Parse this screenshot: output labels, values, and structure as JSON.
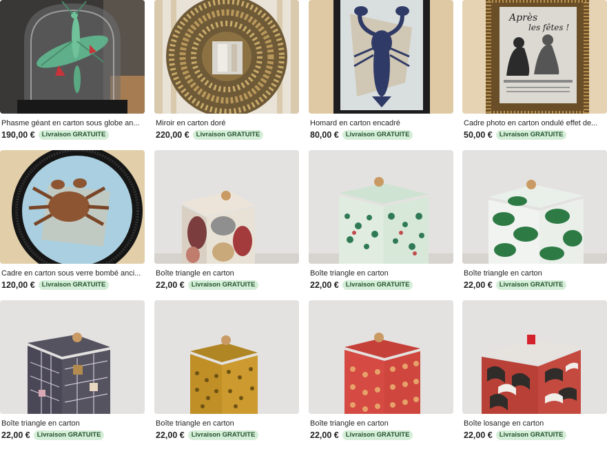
{
  "listings": [
    {
      "title": "Phasme géant en carton sous globe an...",
      "price": "190,00 €",
      "badge": "Livraison GRATUITE",
      "image_icon": "insect-globe-image"
    },
    {
      "title": "Miroir en carton doré",
      "price": "220,00 €",
      "badge": "Livraison GRATUITE",
      "image_icon": "mirror-image"
    },
    {
      "title": "Homard en carton encadré",
      "price": "80,00 €",
      "badge": "Livraison GRATUITE",
      "image_icon": "lobster-frame-image"
    },
    {
      "title": "Cadre photo en carton ondulé effet de...",
      "price": "50,00 €",
      "badge": "Livraison GRATUITE",
      "image_icon": "photo-frame-image",
      "image_text": [
        "Après",
        "les fêtes !"
      ]
    },
    {
      "title": "Cadre en carton sous verre bombé anci...",
      "price": "120,00 €",
      "badge": "Livraison GRATUITE",
      "image_icon": "crab-frame-image"
    },
    {
      "title": "Boîte triangle en carton",
      "price": "22,00 €",
      "badge": "Livraison GRATUITE",
      "image_icon": "box-image"
    },
    {
      "title": "Boîte triangle en carton",
      "price": "22,00 €",
      "badge": "Livraison GRATUITE",
      "image_icon": "box-image"
    },
    {
      "title": "Boîte triangle en carton",
      "price": "22,00 €",
      "badge": "Livraison GRATUITE",
      "image_icon": "box-image"
    },
    {
      "title": "Boîte triangle en carton",
      "price": "22,00 €",
      "badge": "Livraison GRATUITE",
      "image_icon": "box-image"
    },
    {
      "title": "Boîte triangle en carton",
      "price": "22,00 €",
      "badge": "Livraison GRATUITE",
      "image_icon": "box-image"
    },
    {
      "title": "Boîte triangle en carton",
      "price": "22,00 €",
      "badge": "Livraison GRATUITE",
      "image_icon": "box-image"
    },
    {
      "title": "Boîte losange en carton",
      "price": "22,00 €",
      "badge": "Livraison GRATUITE",
      "image_icon": "box-image"
    }
  ],
  "colors": {
    "badge_bg": "#d5eed8",
    "badge_text": "#24532f",
    "text": "#222222"
  }
}
